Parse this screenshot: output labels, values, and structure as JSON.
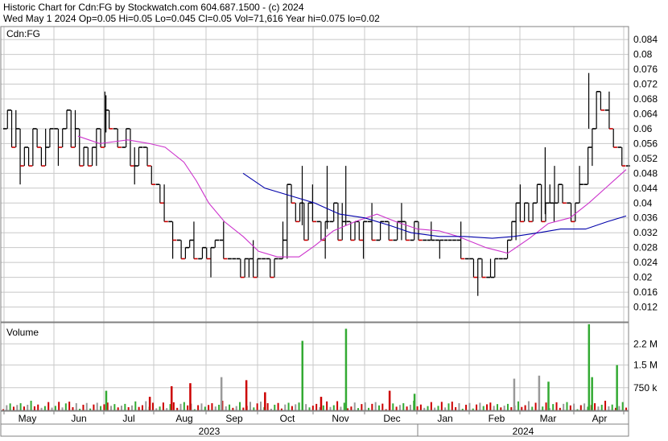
{
  "header": {
    "line1": "Historic Chart for Cdn:FG by Stockwatch.com 604.687.1500 - (c) 2024",
    "line2": "Wed May  1 2024   Op=0.05  Hi=0.05  Lo=0.045  Cl=0.05  Vol=71,616  Year hi=0.075  lo=0.02"
  },
  "colors": {
    "background": "#ffffff",
    "grid": "#c8c8c8",
    "frame": "#808080",
    "down_bar": "#cc0000",
    "up_bar": "#000000",
    "ma_short": "#cc33cc",
    "ma_long": "#0000aa",
    "vol_up": "#33aa33",
    "vol_down": "#cc0000",
    "vol_flat": "#999999"
  },
  "chart_data": [
    {
      "type": "ohlc",
      "title": "Cdn:FG",
      "xlabel": "",
      "ylabel": "",
      "ylim": [
        0.008,
        0.0875
      ],
      "ytick_labels": [
        "0.084",
        "0.08",
        "0.076",
        "0.072",
        "0.068",
        "0.064",
        "0.06",
        "0.056",
        "0.052",
        "0.048",
        "0.044",
        "0.04",
        "0.036",
        "0.032",
        "0.028",
        "0.024",
        "0.02",
        "0.016",
        "0.012"
      ],
      "x_month_labels": [
        "May",
        "Jun",
        "Jul",
        "Aug",
        "Sep",
        "Oct",
        "Nov",
        "Dec",
        "Jan",
        "Feb",
        "Mar",
        "Apr"
      ],
      "x_year_labels": [
        "2023",
        "2024"
      ],
      "grid": true,
      "series_close": [
        0.06,
        0.065,
        0.055,
        0.06,
        0.05,
        0.055,
        0.05,
        0.06,
        0.055,
        0.05,
        0.055,
        0.06,
        0.06,
        0.055,
        0.06,
        0.065,
        0.055,
        0.06,
        0.05,
        0.055,
        0.05,
        0.055,
        0.06,
        0.055,
        0.065,
        0.06,
        0.06,
        0.055,
        0.055,
        0.06,
        0.05,
        0.05,
        0.055,
        0.055,
        0.05,
        0.045,
        0.045,
        0.04,
        0.035,
        0.035,
        0.03,
        0.03,
        0.025,
        0.028,
        0.03,
        0.025,
        0.025,
        0.028,
        0.025,
        0.028,
        0.03,
        0.03,
        0.025,
        0.025,
        0.025,
        0.025,
        0.02,
        0.025,
        0.025,
        0.02,
        0.025,
        0.025,
        0.025,
        0.02,
        0.025,
        0.025,
        0.03,
        0.045,
        0.04,
        0.035,
        0.04,
        0.03,
        0.04,
        0.035,
        0.035,
        0.03,
        0.035,
        0.035,
        0.04,
        0.03,
        0.035,
        0.035,
        0.03,
        0.035,
        0.03,
        0.035,
        0.035,
        0.03,
        0.03,
        0.035,
        0.035,
        0.03,
        0.03,
        0.035,
        0.035,
        0.03,
        0.03,
        0.035,
        0.03,
        0.03,
        0.03,
        0.03,
        0.03,
        0.03,
        0.03,
        0.03,
        0.03,
        0.03,
        0.025,
        0.025,
        0.025,
        0.02,
        0.025,
        0.02,
        0.02,
        0.02,
        0.025,
        0.025,
        0.025,
        0.03,
        0.035,
        0.04,
        0.035,
        0.04,
        0.035,
        0.04,
        0.045,
        0.035,
        0.04,
        0.04,
        0.04,
        0.045,
        0.04,
        0.04,
        0.035,
        0.04,
        0.045,
        0.045,
        0.055,
        0.06,
        0.07,
        0.065,
        0.065,
        0.06,
        0.055,
        0.055,
        0.05,
        0.05
      ],
      "ma_short": [
        {
          "x": 0.12,
          "y": 0.058
        },
        {
          "x": 0.155,
          "y": 0.056
        },
        {
          "x": 0.2,
          "y": 0.057
        },
        {
          "x": 0.235,
          "y": 0.056
        },
        {
          "x": 0.26,
          "y": 0.055
        },
        {
          "x": 0.29,
          "y": 0.051
        },
        {
          "x": 0.31,
          "y": 0.046
        },
        {
          "x": 0.33,
          "y": 0.04
        },
        {
          "x": 0.355,
          "y": 0.035
        },
        {
          "x": 0.385,
          "y": 0.031
        },
        {
          "x": 0.41,
          "y": 0.027
        },
        {
          "x": 0.44,
          "y": 0.0255
        },
        {
          "x": 0.475,
          "y": 0.0255
        },
        {
          "x": 0.5,
          "y": 0.0285
        },
        {
          "x": 0.53,
          "y": 0.0325
        },
        {
          "x": 0.565,
          "y": 0.035
        },
        {
          "x": 0.6,
          "y": 0.037
        },
        {
          "x": 0.63,
          "y": 0.035
        },
        {
          "x": 0.665,
          "y": 0.033
        },
        {
          "x": 0.7,
          "y": 0.0325
        },
        {
          "x": 0.73,
          "y": 0.031
        },
        {
          "x": 0.775,
          "y": 0.028
        },
        {
          "x": 0.81,
          "y": 0.0265
        },
        {
          "x": 0.845,
          "y": 0.0305
        },
        {
          "x": 0.875,
          "y": 0.0345
        },
        {
          "x": 0.91,
          "y": 0.036
        },
        {
          "x": 0.94,
          "y": 0.04
        },
        {
          "x": 0.97,
          "y": 0.0445
        },
        {
          "x": 1.0,
          "y": 0.049
        }
      ],
      "ma_long": [
        {
          "x": 0.385,
          "y": 0.048
        },
        {
          "x": 0.42,
          "y": 0.044
        },
        {
          "x": 0.46,
          "y": 0.042
        },
        {
          "x": 0.5,
          "y": 0.04
        },
        {
          "x": 0.54,
          "y": 0.037
        },
        {
          "x": 0.58,
          "y": 0.036
        },
        {
          "x": 0.62,
          "y": 0.034
        },
        {
          "x": 0.655,
          "y": 0.032
        },
        {
          "x": 0.7,
          "y": 0.031
        },
        {
          "x": 0.74,
          "y": 0.031
        },
        {
          "x": 0.785,
          "y": 0.0305
        },
        {
          "x": 0.82,
          "y": 0.031
        },
        {
          "x": 0.86,
          "y": 0.032
        },
        {
          "x": 0.895,
          "y": 0.033
        },
        {
          "x": 0.935,
          "y": 0.033
        },
        {
          "x": 0.97,
          "y": 0.035
        },
        {
          "x": 1.0,
          "y": 0.0365
        }
      ]
    },
    {
      "type": "bar",
      "title": "Volume",
      "ylim": [
        0,
        2900000
      ],
      "ytick_labels": [
        "2.2 M",
        "1.5 M",
        "750 k"
      ],
      "ytick_values": [
        2200000,
        1500000,
        750000
      ],
      "grid": true,
      "volume_spikes": [
        {
          "x": 0.165,
          "v": 650000,
          "c": "up"
        },
        {
          "x": 0.235,
          "v": 450000,
          "c": "down"
        },
        {
          "x": 0.27,
          "v": 800000,
          "c": "down"
        },
        {
          "x": 0.3,
          "v": 900000,
          "c": "down"
        },
        {
          "x": 0.35,
          "v": 1100000,
          "c": "flat"
        },
        {
          "x": 0.39,
          "v": 1000000,
          "c": "down"
        },
        {
          "x": 0.42,
          "v": 600000,
          "c": "down"
        },
        {
          "x": 0.48,
          "v": 2300000,
          "c": "up"
        },
        {
          "x": 0.51,
          "v": 450000,
          "c": "down"
        },
        {
          "x": 0.55,
          "v": 2700000,
          "c": "up"
        },
        {
          "x": 0.62,
          "v": 650000,
          "c": "down"
        },
        {
          "x": 0.66,
          "v": 550000,
          "c": "up"
        },
        {
          "x": 0.82,
          "v": 1050000,
          "c": "flat"
        },
        {
          "x": 0.86,
          "v": 1150000,
          "c": "flat"
        },
        {
          "x": 0.875,
          "v": 950000,
          "c": "up"
        },
        {
          "x": 0.94,
          "v": 2850000,
          "c": "up"
        },
        {
          "x": 0.945,
          "v": 1100000,
          "c": "up"
        },
        {
          "x": 0.985,
          "v": 1500000,
          "c": "up"
        }
      ]
    }
  ]
}
